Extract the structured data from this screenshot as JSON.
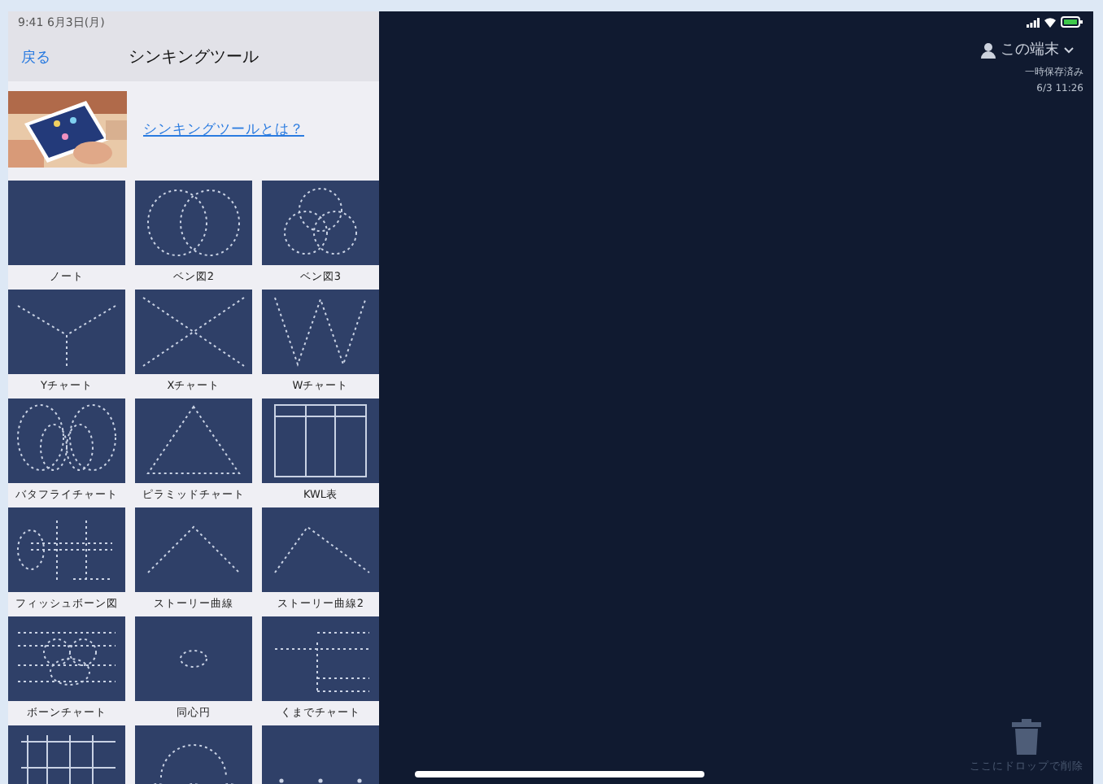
{
  "status_bar": {
    "time": "9:41 6月3日(月)"
  },
  "nav": {
    "back": "戻る",
    "title": "シンキングツール"
  },
  "intro": {
    "link": "シンキングツールとは？"
  },
  "templates": [
    {
      "kind": "blank",
      "label": "ノート"
    },
    {
      "kind": "venn2",
      "label": "ベン図2"
    },
    {
      "kind": "venn3",
      "label": "ベン図3"
    },
    {
      "kind": "y",
      "label": "Yチャート"
    },
    {
      "kind": "x",
      "label": "Xチャート"
    },
    {
      "kind": "w",
      "label": "Wチャート"
    },
    {
      "kind": "butterfly",
      "label": "バタフライチャート"
    },
    {
      "kind": "pyramid",
      "label": "ピラミッドチャート"
    },
    {
      "kind": "table",
      "label": "KWL表"
    },
    {
      "kind": "fishbone",
      "label": "フィッシュボーン図"
    },
    {
      "kind": "mountain",
      "label": "ストーリー曲線"
    },
    {
      "kind": "mountain2",
      "label": "ストーリー曲線2"
    },
    {
      "kind": "bone",
      "label": "ボーンチャート"
    },
    {
      "kind": "circle",
      "label": "同心円"
    },
    {
      "kind": "rake",
      "label": "くまでチャート"
    },
    {
      "kind": "grid"
    },
    {
      "kind": "concentric"
    },
    {
      "kind": "dots"
    }
  ],
  "account": {
    "name": "この端末",
    "line1": "一時保存済み",
    "line2": "6/3 11:26"
  },
  "trash": {
    "label": "ここにドロップで削除"
  }
}
